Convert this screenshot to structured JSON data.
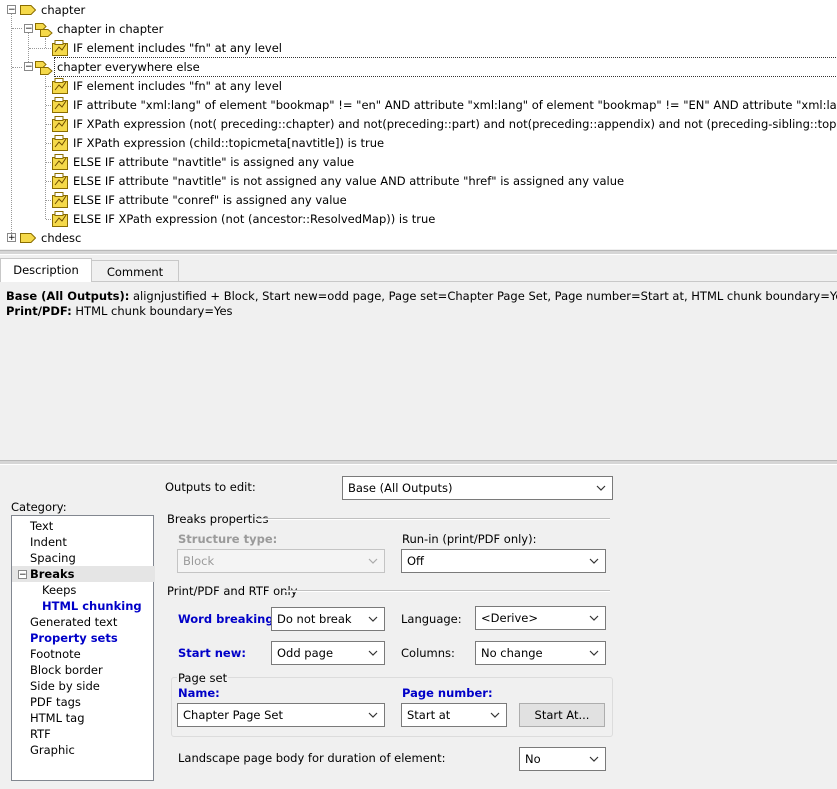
{
  "tree": {
    "root": "chapter",
    "context1": "chapter in chapter",
    "context1_cond": "IF element includes \"fn\" at any level",
    "context2": "chapter everywhere else",
    "context2_conds": [
      "IF element includes \"fn\" at any level",
      "IF attribute \"xml:lang\" of element \"bookmap\" != \"en\" AND attribute \"xml:lang\" of element \"bookmap\" != \"EN\" AND attribute \"xml:lang\" of eleme",
      "IF XPath expression (not( preceding::chapter) and not(preceding::part) and not(preceding::appendix) and not (preceding-sibling::topic)) is true",
      "IF XPath expression (child::topicmeta[navtitle]) is true",
      "ELSE IF attribute \"navtitle\" is assigned any value",
      "ELSE IF attribute \"navtitle\" is not assigned any value AND attribute \"href\" is assigned any value",
      "ELSE IF attribute \"conref\" is assigned any value",
      "ELSE IF XPath expression (not (ancestor::ResolvedMap)) is true"
    ],
    "sibling": "chdesc",
    "collapse_glyph": "−",
    "expand_glyph": "+"
  },
  "tabs": {
    "description": "Description",
    "comment": "Comment"
  },
  "description": {
    "line1_label": "Base (All Outputs):",
    "line1_text": "alignjustified + Block, Start new=odd page, Page set=Chapter Page Set, Page number=Start at, HTML chunk boundary=Yes",
    "line2_label": "Print/PDF:",
    "line2_text": "HTML chunk boundary=Yes"
  },
  "category": {
    "label": "Category:",
    "items": [
      "Text",
      "Indent",
      "Spacing",
      "Breaks",
      "Keeps",
      "HTML chunking",
      "Generated text",
      "Property sets",
      "Footnote",
      "Block border",
      "Side by side",
      "PDF tags",
      "HTML tag",
      "RTF",
      "Graphic"
    ],
    "expand_glyph": "−"
  },
  "outputs": {
    "label": "Outputs to edit:",
    "value": "Base (All Outputs)"
  },
  "breaks": {
    "section": "Breaks properties",
    "structure_label": "Structure type:",
    "structure_value": "Block",
    "runin_label": "Run-in (print/PDF only):",
    "runin_value": "Off"
  },
  "printpdf": {
    "section": "Print/PDF and RTF only",
    "word_label": "Word breaking:",
    "word_value": "Do not break",
    "language_label": "Language:",
    "language_value": "<Derive>",
    "startnew_label": "Start new:",
    "startnew_value": "Odd page",
    "columns_label": "Columns:",
    "columns_value": "No change"
  },
  "pageset": {
    "legend": "Page set",
    "name_label": "Name:",
    "name_value": "Chapter Page Set",
    "pagenum_label": "Page number:",
    "pagenum_value": "Start at",
    "start_at_button": "Start At..."
  },
  "landscape": {
    "label": "Landscape page body for duration of element:",
    "value": "No"
  },
  "colors": {
    "accent_blue": "#0000c8",
    "tag_yellow": "#f5d94a"
  },
  "icons": [
    "element-tag-icon",
    "condition-icon",
    "chevron-down-icon",
    "expand-icon",
    "collapse-icon"
  ]
}
